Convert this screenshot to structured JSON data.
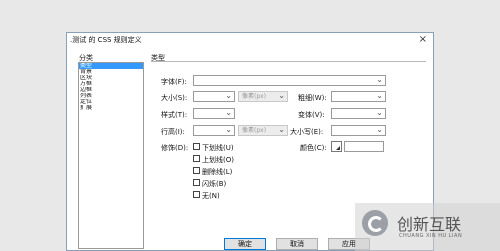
{
  "dialog": {
    "title": ".测试 的 CSS 规则定义",
    "close_symbol": "×"
  },
  "category": {
    "label": "分类",
    "items": [
      "类型",
      "背景",
      "区块",
      "方框",
      "边框",
      "列表",
      "定位",
      "扩展"
    ],
    "selected_index": 0
  },
  "type_panel": {
    "heading": "类型",
    "font_family_label": "字体(F):",
    "font_size_label": "大小(S):",
    "font_size_unit": "像素(px)",
    "font_weight_label": "粗细(W):",
    "font_style_label": "样式(T):",
    "font_variant_label": "变体(V):",
    "line_height_label": "行高(I):",
    "line_height_unit": "像素(px)",
    "text_transform_label": "大小写(E):",
    "text_decoration_label": "修饰(D):",
    "decoration_options": [
      "下划线(U)",
      "上划线(O)",
      "删除线(L)",
      "闪烁(B)",
      "无(N)"
    ],
    "color_label": "颜色(C):"
  },
  "buttons": {
    "ok": "确定",
    "cancel": "取消",
    "apply": "应用"
  },
  "watermark": {
    "text": "创新互联",
    "subtext": "CHUANG XIN HU LIAN"
  }
}
